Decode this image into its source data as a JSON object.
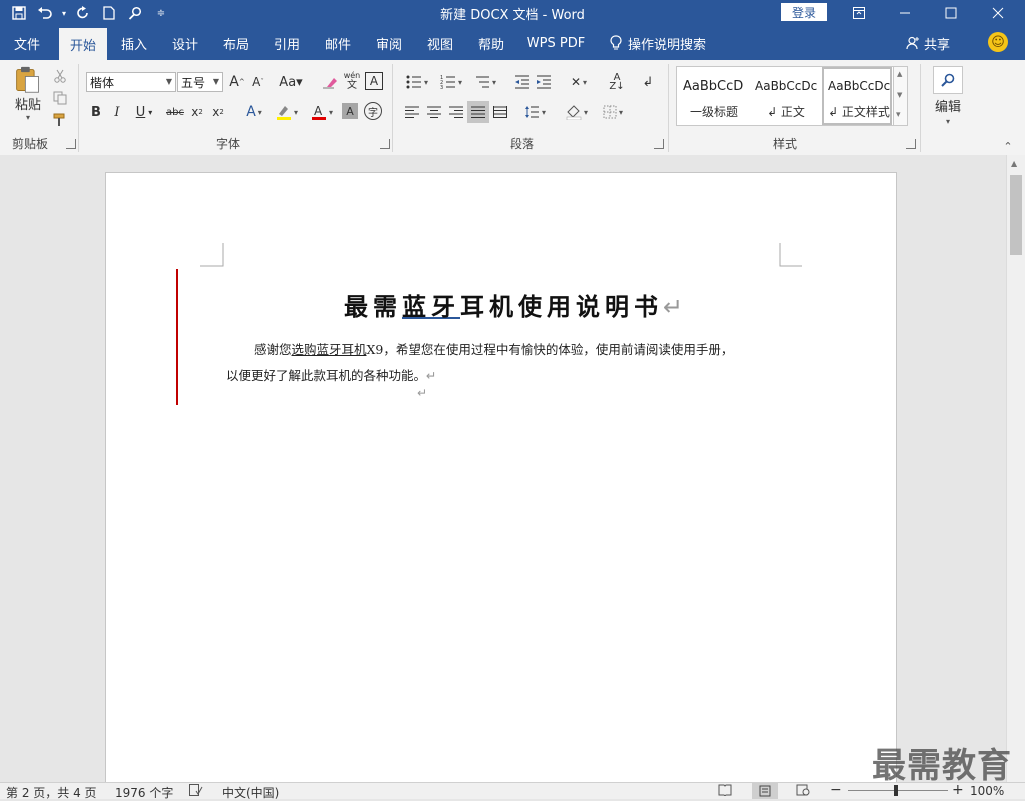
{
  "window": {
    "title": "新建 DOCX 文档 - Word",
    "login_label": "登录"
  },
  "tabs": [
    "文件",
    "开始",
    "插入",
    "设计",
    "布局",
    "引用",
    "邮件",
    "审阅",
    "视图",
    "帮助",
    "WPS PDF"
  ],
  "active_tab": "开始",
  "tellme": "操作说明搜索",
  "share": "共享",
  "ribbon": {
    "clipboard": {
      "paste_label": "粘贴",
      "group_label": "剪贴板"
    },
    "font": {
      "font_name": "楷体",
      "font_size": "五号",
      "group_label": "字体"
    },
    "paragraph": {
      "group_label": "段落"
    },
    "styles": {
      "group_label": "样式",
      "items": [
        {
          "sample": "AaBbCcD",
          "name": "一级标题"
        },
        {
          "sample": "AaBbCcDc",
          "name": "↲ 正文"
        },
        {
          "sample": "AaBbCcDc",
          "name": "↲ 正文样式"
        }
      ]
    },
    "editing": {
      "label": "编辑"
    }
  },
  "document": {
    "title_part1": "最需",
    "title_underlined": "蓝牙",
    "title_part2": "耳机使用说明书",
    "para1_part1": "感谢您",
    "para1_underlined": "选购蓝牙耳机",
    "para1_part2": "X9，希望您在使用过程中有愉快的体验，使用前请阅读使用手册，",
    "para2": "以便更好了解此款耳机的各种功能。",
    "return_mark": "↵"
  },
  "watermark": "最需教育",
  "status": {
    "page": "第 2 页，共 4 页",
    "words": "1976 个字",
    "language": "中文(中国)",
    "zoom": "100%"
  }
}
